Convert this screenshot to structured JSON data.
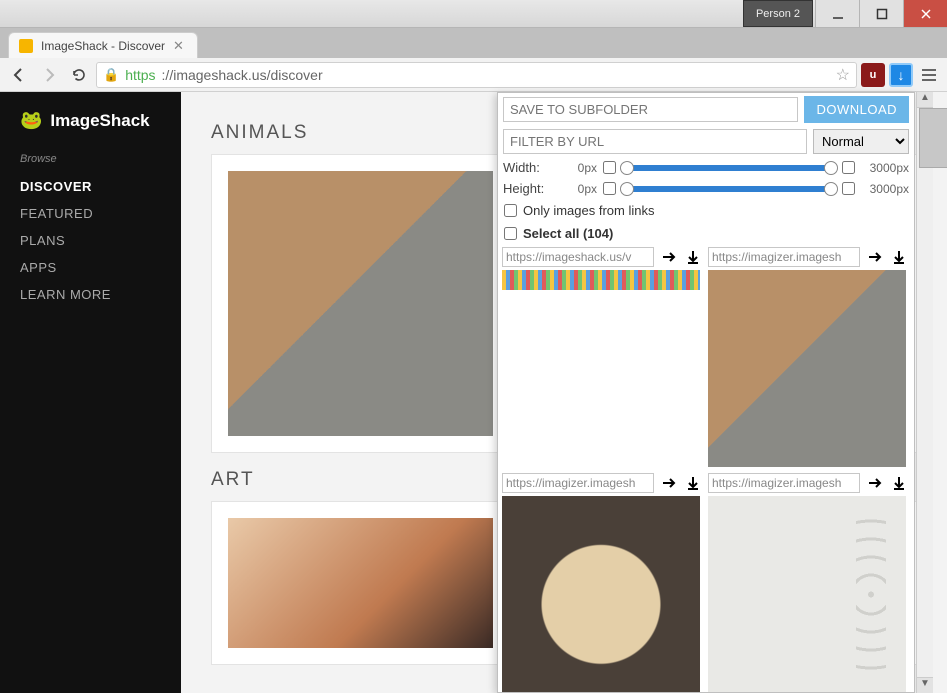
{
  "os": {
    "profile": "Person 2"
  },
  "tab": {
    "title": "ImageShack - Discover"
  },
  "address": {
    "protocol": "https",
    "rest": "://imageshack.us/discover"
  },
  "logo": {
    "text": "ImageShack"
  },
  "sidebar": {
    "heading": "Browse",
    "items": [
      {
        "label": "DISCOVER",
        "active": true
      },
      {
        "label": "FEATURED"
      },
      {
        "label": "PLANS"
      },
      {
        "label": "APPS"
      },
      {
        "label": "LEARN MORE"
      }
    ]
  },
  "sections": [
    {
      "title": "ANIMALS"
    },
    {
      "title": "ART"
    }
  ],
  "popup": {
    "subfolder_placeholder": "SAVE TO SUBFOLDER",
    "download_label": "DOWNLOAD",
    "filter_placeholder": "FILTER BY URL",
    "filter_mode": "Normal",
    "width_label": "Width:",
    "height_label": "Height:",
    "min_px": "0px",
    "max_px": "3000px",
    "only_links_label": "Only images from links",
    "select_all_label": "Select all (104)",
    "items": [
      {
        "url": "https://imageshack.us/v"
      },
      {
        "url": "https://imagizer.imagesh"
      },
      {
        "url": "https://imagizer.imagesh"
      },
      {
        "url": "https://imagizer.imagesh"
      }
    ]
  }
}
